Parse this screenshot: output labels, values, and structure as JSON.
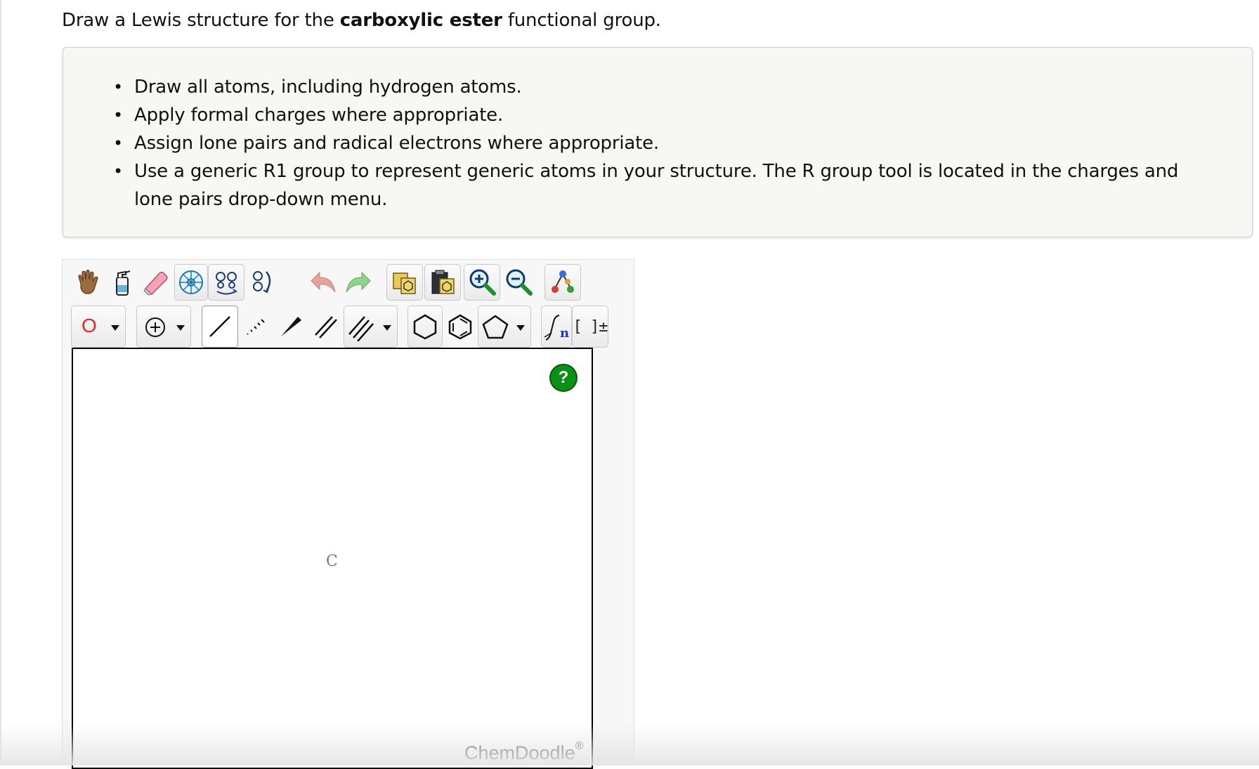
{
  "question": {
    "prefix": "Draw a Lewis structure for the ",
    "bold_term": "carboxylic ester",
    "suffix": " functional group."
  },
  "instructions": [
    "Draw all atoms, including hydrogen atoms.",
    "Apply formal charges where appropriate.",
    "Assign lone pairs and radical electrons where appropriate.",
    "Use a generic R1 group to represent generic atoms in your structure. The R group tool is located in the charges and lone pairs drop-down menu."
  ],
  "toolbar": {
    "atom_selector_label": "O",
    "atom_selector_color": "#e8271f",
    "bracket_label": "[ ]±",
    "repeat_unit_label": "n"
  },
  "canvas": {
    "atom_label": "C",
    "help_label": "?",
    "brand_name": "ChemDoodle",
    "brand_mark": "®"
  },
  "colors": {
    "help_button": "#0a8f17",
    "panel_background": "#f7f8f3"
  }
}
